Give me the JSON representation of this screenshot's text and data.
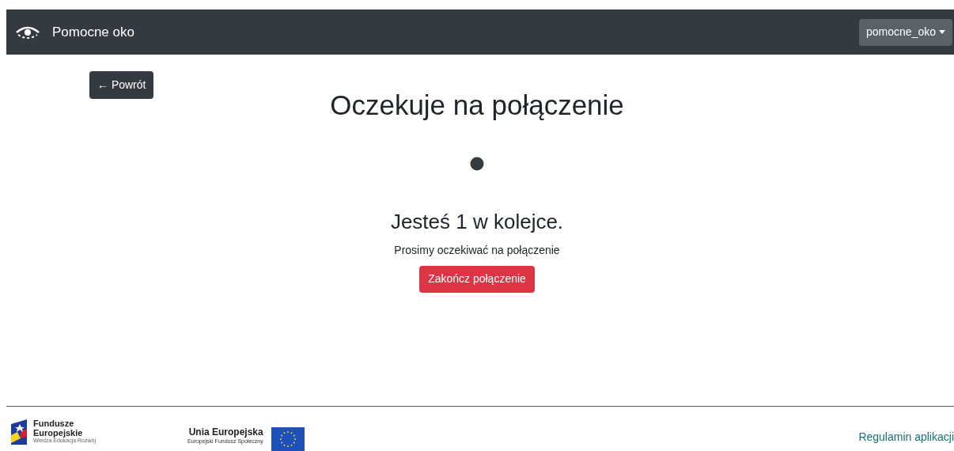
{
  "navbar": {
    "brand": "Pomocne oko",
    "user_menu": "pomocne_oko"
  },
  "back_button": "← Powrót",
  "title": "Oczekuje na połączenie",
  "queue": {
    "heading": "Jesteś 1 w kolejce.",
    "message": "Prosimy oczekiwać na połączenie",
    "end_button": "Zakończ połączenie"
  },
  "footer": {
    "fe_logo": {
      "line1": "Fundusze",
      "line2": "Europejskie",
      "line3": "Wiedza Edukacja Rozwój"
    },
    "eu_logo": {
      "line1": "Unia Europejska",
      "line2": "Europejski Fundusz Społeczny"
    },
    "link": "Regulamin aplikacji"
  }
}
